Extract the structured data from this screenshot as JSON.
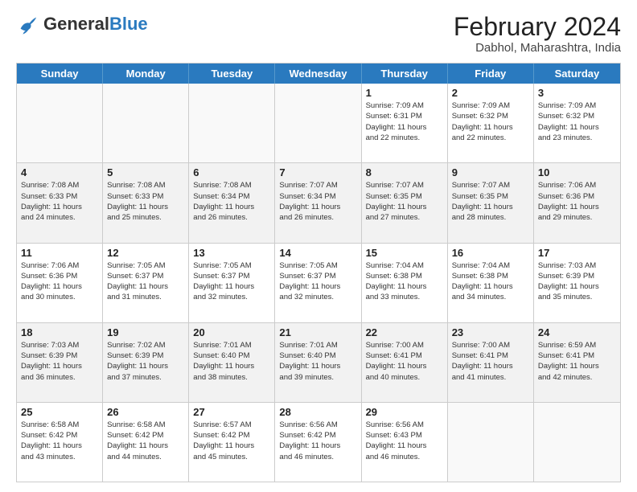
{
  "header": {
    "logo_general": "General",
    "logo_blue": "Blue",
    "month_title": "February 2024",
    "location": "Dabhol, Maharashtra, India"
  },
  "days_of_week": [
    "Sunday",
    "Monday",
    "Tuesday",
    "Wednesday",
    "Thursday",
    "Friday",
    "Saturday"
  ],
  "rows": [
    [
      {
        "day": "",
        "info": "",
        "empty": true
      },
      {
        "day": "",
        "info": "",
        "empty": true
      },
      {
        "day": "",
        "info": "",
        "empty": true
      },
      {
        "day": "",
        "info": "",
        "empty": true
      },
      {
        "day": "1",
        "info": "Sunrise: 7:09 AM\nSunset: 6:31 PM\nDaylight: 11 hours\nand 22 minutes."
      },
      {
        "day": "2",
        "info": "Sunrise: 7:09 AM\nSunset: 6:32 PM\nDaylight: 11 hours\nand 22 minutes."
      },
      {
        "day": "3",
        "info": "Sunrise: 7:09 AM\nSunset: 6:32 PM\nDaylight: 11 hours\nand 23 minutes."
      }
    ],
    [
      {
        "day": "4",
        "info": "Sunrise: 7:08 AM\nSunset: 6:33 PM\nDaylight: 11 hours\nand 24 minutes."
      },
      {
        "day": "5",
        "info": "Sunrise: 7:08 AM\nSunset: 6:33 PM\nDaylight: 11 hours\nand 25 minutes."
      },
      {
        "day": "6",
        "info": "Sunrise: 7:08 AM\nSunset: 6:34 PM\nDaylight: 11 hours\nand 26 minutes."
      },
      {
        "day": "7",
        "info": "Sunrise: 7:07 AM\nSunset: 6:34 PM\nDaylight: 11 hours\nand 26 minutes."
      },
      {
        "day": "8",
        "info": "Sunrise: 7:07 AM\nSunset: 6:35 PM\nDaylight: 11 hours\nand 27 minutes."
      },
      {
        "day": "9",
        "info": "Sunrise: 7:07 AM\nSunset: 6:35 PM\nDaylight: 11 hours\nand 28 minutes."
      },
      {
        "day": "10",
        "info": "Sunrise: 7:06 AM\nSunset: 6:36 PM\nDaylight: 11 hours\nand 29 minutes."
      }
    ],
    [
      {
        "day": "11",
        "info": "Sunrise: 7:06 AM\nSunset: 6:36 PM\nDaylight: 11 hours\nand 30 minutes."
      },
      {
        "day": "12",
        "info": "Sunrise: 7:05 AM\nSunset: 6:37 PM\nDaylight: 11 hours\nand 31 minutes."
      },
      {
        "day": "13",
        "info": "Sunrise: 7:05 AM\nSunset: 6:37 PM\nDaylight: 11 hours\nand 32 minutes."
      },
      {
        "day": "14",
        "info": "Sunrise: 7:05 AM\nSunset: 6:37 PM\nDaylight: 11 hours\nand 32 minutes."
      },
      {
        "day": "15",
        "info": "Sunrise: 7:04 AM\nSunset: 6:38 PM\nDaylight: 11 hours\nand 33 minutes."
      },
      {
        "day": "16",
        "info": "Sunrise: 7:04 AM\nSunset: 6:38 PM\nDaylight: 11 hours\nand 34 minutes."
      },
      {
        "day": "17",
        "info": "Sunrise: 7:03 AM\nSunset: 6:39 PM\nDaylight: 11 hours\nand 35 minutes."
      }
    ],
    [
      {
        "day": "18",
        "info": "Sunrise: 7:03 AM\nSunset: 6:39 PM\nDaylight: 11 hours\nand 36 minutes."
      },
      {
        "day": "19",
        "info": "Sunrise: 7:02 AM\nSunset: 6:39 PM\nDaylight: 11 hours\nand 37 minutes."
      },
      {
        "day": "20",
        "info": "Sunrise: 7:01 AM\nSunset: 6:40 PM\nDaylight: 11 hours\nand 38 minutes."
      },
      {
        "day": "21",
        "info": "Sunrise: 7:01 AM\nSunset: 6:40 PM\nDaylight: 11 hours\nand 39 minutes."
      },
      {
        "day": "22",
        "info": "Sunrise: 7:00 AM\nSunset: 6:41 PM\nDaylight: 11 hours\nand 40 minutes."
      },
      {
        "day": "23",
        "info": "Sunrise: 7:00 AM\nSunset: 6:41 PM\nDaylight: 11 hours\nand 41 minutes."
      },
      {
        "day": "24",
        "info": "Sunrise: 6:59 AM\nSunset: 6:41 PM\nDaylight: 11 hours\nand 42 minutes."
      }
    ],
    [
      {
        "day": "25",
        "info": "Sunrise: 6:58 AM\nSunset: 6:42 PM\nDaylight: 11 hours\nand 43 minutes."
      },
      {
        "day": "26",
        "info": "Sunrise: 6:58 AM\nSunset: 6:42 PM\nDaylight: 11 hours\nand 44 minutes."
      },
      {
        "day": "27",
        "info": "Sunrise: 6:57 AM\nSunset: 6:42 PM\nDaylight: 11 hours\nand 45 minutes."
      },
      {
        "day": "28",
        "info": "Sunrise: 6:56 AM\nSunset: 6:42 PM\nDaylight: 11 hours\nand 46 minutes."
      },
      {
        "day": "29",
        "info": "Sunrise: 6:56 AM\nSunset: 6:43 PM\nDaylight: 11 hours\nand 46 minutes."
      },
      {
        "day": "",
        "info": "",
        "empty": true
      },
      {
        "day": "",
        "info": "",
        "empty": true
      }
    ]
  ]
}
